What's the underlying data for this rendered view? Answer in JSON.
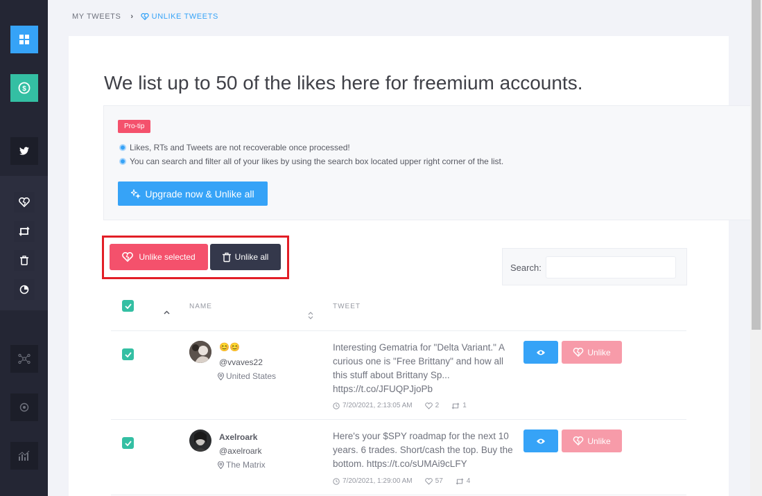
{
  "sidebar": {
    "items": [
      {
        "name": "dashboard-icon",
        "color": "#36a3f7"
      },
      {
        "name": "dollar-icon",
        "color": "#34bfa3"
      },
      {
        "name": "twitter-icon"
      },
      {
        "name": "unlike-heart-icon"
      },
      {
        "name": "retweet-icon"
      },
      {
        "name": "trash-icon"
      },
      {
        "name": "pie-icon"
      },
      {
        "name": "network-icon"
      },
      {
        "name": "circle-icon"
      },
      {
        "name": "stats-icon"
      }
    ]
  },
  "breadcrumb": {
    "home": "MY TWEETS",
    "current": "UNLIKE TWEETS"
  },
  "page": {
    "title": "We list up to 50 of the likes here for freemium accounts."
  },
  "protip": {
    "badge": "Pro-tip",
    "lines": [
      "Likes, RTs and Tweets are not recoverable once processed!",
      "You can search and filter all of your likes by using the search box located upper right corner of the list."
    ],
    "upgrade_label": "Upgrade now & Unlike all"
  },
  "actions": {
    "unlike_selected": "Unlike selected",
    "unlike_all": "Unlike all"
  },
  "search": {
    "label": "Search:",
    "value": ""
  },
  "table": {
    "headers": {
      "name": "NAME",
      "tweet": "TWEET"
    },
    "rows": [
      {
        "name": "😊😊",
        "handle": "@vvaves22",
        "location": "United States",
        "tweet": "Interesting Gematria for \"Delta Variant.\" A curious one is \"Free Brittany\" and how all this stuff about Brittany Sp... https://t.co/JFUQPJjoPb",
        "date": "7/20/2021, 2:13:05 AM",
        "likes": "2",
        "retweets": "1",
        "unlike_label": "Unlike"
      },
      {
        "name": "Axelroark",
        "handle": "@axelroark",
        "location": "The Matrix",
        "tweet": "Here's your $SPY roadmap for the next 10 years. 6 trades. Short/cash the top. Buy the bottom. https://t.co/sUMAi9cLFY",
        "date": "7/20/2021, 1:29:00 AM",
        "likes": "57",
        "retweets": "4",
        "unlike_label": "Unlike"
      }
    ]
  },
  "colors": {
    "brand_blue": "#36a3f7",
    "danger": "#f4516c",
    "success": "#34bfa3",
    "dark": "#34384b",
    "highlight": "#e21e26"
  }
}
